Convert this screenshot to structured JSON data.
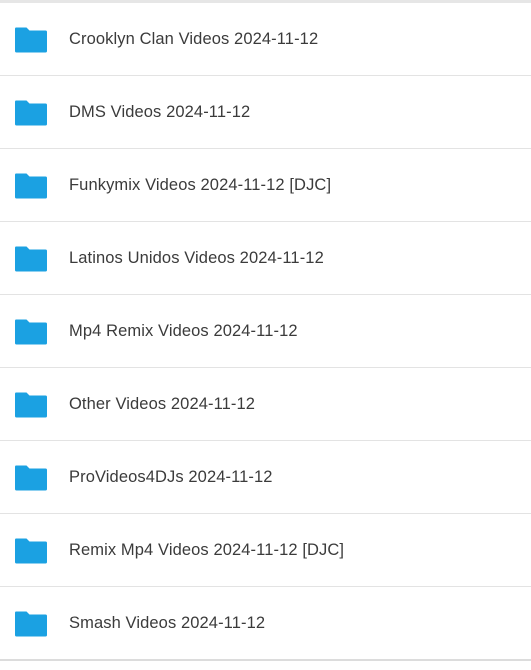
{
  "colors": {
    "folder_icon": "#1ba1e2",
    "text": "#3b3b3b",
    "divider": "#e3e3e3"
  },
  "folders": [
    {
      "label": "Crooklyn Clan Videos 2024-11-12",
      "icon": "folder-icon"
    },
    {
      "label": "DMS Videos 2024-11-12",
      "icon": "folder-icon"
    },
    {
      "label": "Funkymix Videos 2024-11-12 [DJC]",
      "icon": "folder-icon"
    },
    {
      "label": "Latinos Unidos Videos 2024-11-12",
      "icon": "folder-icon"
    },
    {
      "label": "Mp4 Remix Videos 2024-11-12",
      "icon": "folder-icon"
    },
    {
      "label": "Other Videos 2024-11-12",
      "icon": "folder-icon"
    },
    {
      "label": "ProVideos4DJs 2024-11-12",
      "icon": "folder-icon"
    },
    {
      "label": "Remix Mp4 Videos 2024-11-12 [DJC]",
      "icon": "folder-icon"
    },
    {
      "label": "Smash Videos 2024-11-12",
      "icon": "folder-icon"
    }
  ]
}
